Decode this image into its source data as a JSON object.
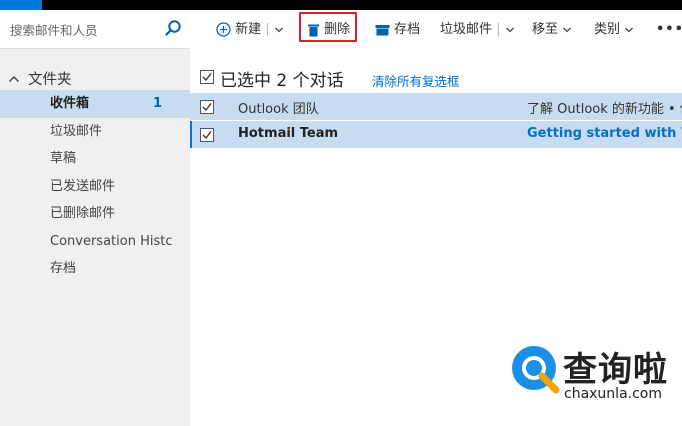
{
  "search": {
    "placeholder": "搜索邮件和人员"
  },
  "folders": {
    "header": "文件夹",
    "items": [
      {
        "label": "收件箱",
        "count": "1",
        "selected": true
      },
      {
        "label": "垃圾邮件"
      },
      {
        "label": "草稿"
      },
      {
        "label": "已发送邮件"
      },
      {
        "label": "已删除邮件"
      },
      {
        "label": "Conversation Histc"
      },
      {
        "label": "存档"
      }
    ]
  },
  "toolbar": {
    "new_label": "新建",
    "delete_label": "删除",
    "archive_label": "存档",
    "junk_label": "垃圾邮件",
    "moveto_label": "移至",
    "category_label": "类别",
    "more_label": "•••"
  },
  "selection": {
    "heading": "已选中 2 个对话",
    "clear_link": "清除所有复选框"
  },
  "messages": [
    {
      "sender": "Outlook 团队",
      "subject": "了解 Outlook 的新功能 • 你",
      "unread": false
    },
    {
      "sender": "Hotmail Team",
      "subject": "Getting started with Win",
      "unread": true
    }
  ],
  "watermark": {
    "brand": "查询啦",
    "site": "chaxunla.com"
  },
  "colors": {
    "accent": "#0078d7",
    "selection": "#c7dcf0",
    "link": "#0070c9",
    "highlight_box": "#d9222a"
  }
}
